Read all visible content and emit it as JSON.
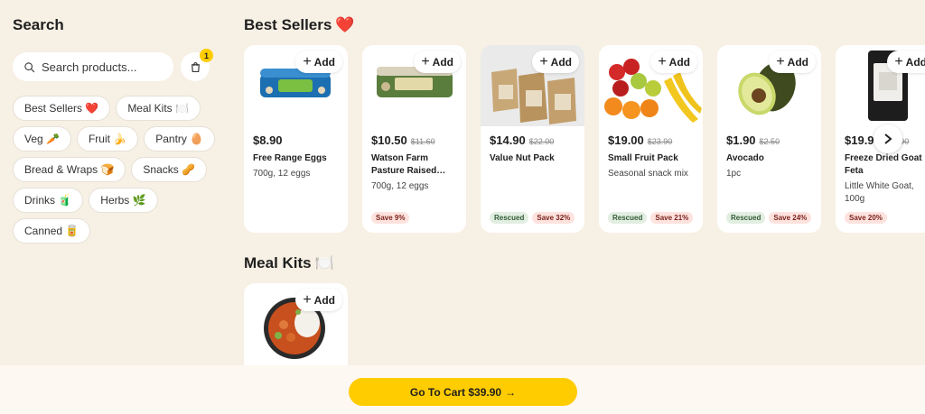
{
  "sidebar": {
    "title": "Search",
    "search_placeholder": "Search products...",
    "cart_count": "1",
    "categories": [
      {
        "label": "Best Sellers ❤️"
      },
      {
        "label": "Meal Kits 🍽️"
      },
      {
        "label": "Veg 🥕"
      },
      {
        "label": "Fruit 🍌"
      },
      {
        "label": "Pantry 🥚"
      },
      {
        "label": "Bread & Wraps 🍞"
      },
      {
        "label": "Snacks 🥜"
      },
      {
        "label": "Drinks 🧃"
      },
      {
        "label": "Herbs 🌿"
      },
      {
        "label": "Canned 🥫"
      }
    ]
  },
  "best_sellers": {
    "title": "Best Sellers",
    "emoji": "❤️",
    "add_label": "Add",
    "products": [
      {
        "price": "$8.90",
        "old_price": "",
        "name": "Free Range Eggs",
        "desc": "700g, 12 eggs",
        "rescued": "",
        "save": ""
      },
      {
        "price": "$10.50",
        "old_price": "$11.60",
        "name": "Watson Farm Pasture Raised…",
        "desc": "700g, 12 eggs",
        "rescued": "",
        "save": "Save 9%"
      },
      {
        "price": "$14.90",
        "old_price": "$22.00",
        "name": "Value Nut Pack",
        "desc": "",
        "rescued": "Rescued",
        "save": "Save 32%"
      },
      {
        "price": "$19.00",
        "old_price": "$23.90",
        "name": "Small Fruit Pack",
        "desc": "Seasonal snack mix",
        "rescued": "Rescued",
        "save": "Save 21%"
      },
      {
        "price": "$1.90",
        "old_price": "$2.50",
        "name": "Avocado",
        "desc": "1pc",
        "rescued": "Rescued",
        "save": "Save 24%"
      },
      {
        "price": "$19.90",
        "old_price": "$24.90",
        "name": "Freeze Dried Goat Feta",
        "desc": "Little White Goat, 100g",
        "rescued": "",
        "save": "Save 20%"
      }
    ]
  },
  "meal_kits": {
    "title": "Meal Kits",
    "emoji": "🍽️",
    "add_label": "Add"
  },
  "footer": {
    "cta_label": "Go To Cart $39.90",
    "arrow": "→"
  }
}
